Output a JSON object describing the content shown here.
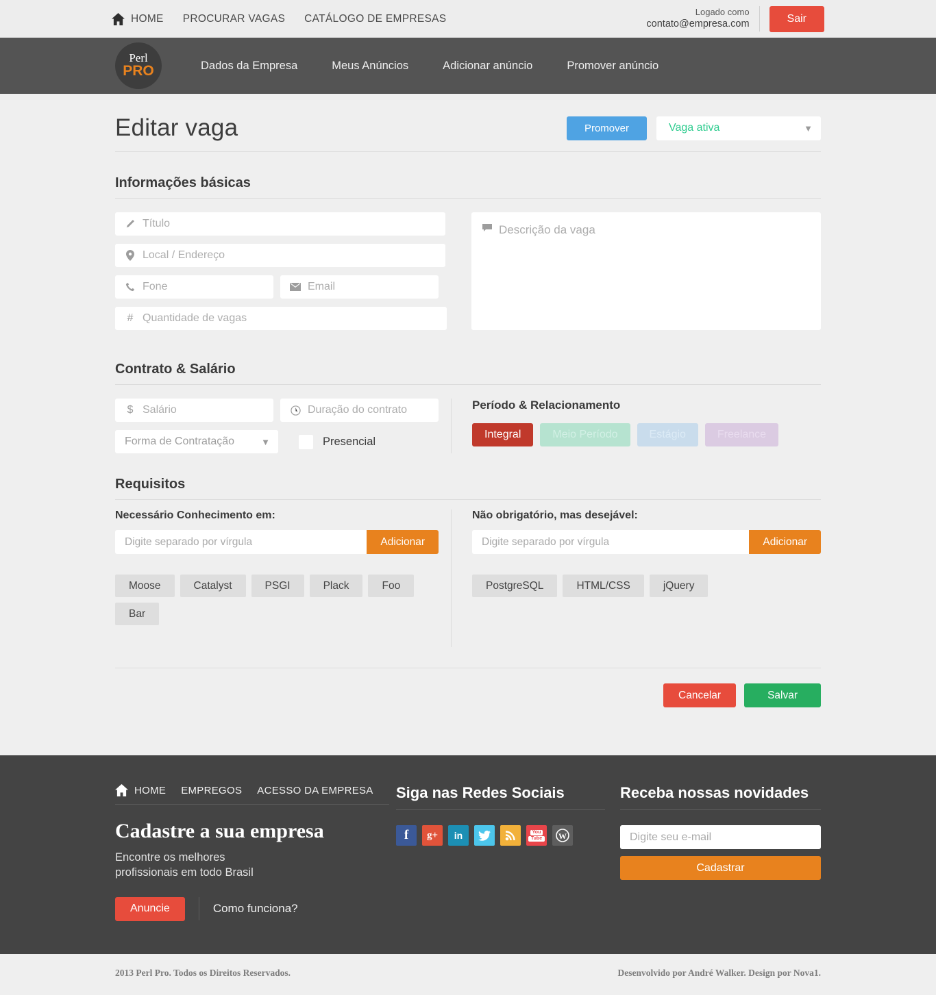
{
  "topbar": {
    "home_label": "HOME",
    "nav": [
      {
        "label": "PROCURAR VAGAS"
      },
      {
        "label": "CATÁLOGO DE EMPRESAS"
      }
    ],
    "logged_as_label": "Logado como",
    "logged_email": "contato@empresa.com",
    "logout_label": "Sair"
  },
  "brandnav": {
    "logo_top": "Perl",
    "logo_bottom": "PRO",
    "items": [
      {
        "label": "Dados da Empresa"
      },
      {
        "label": "Meus Anúncios"
      },
      {
        "label": "Adicionar anúncio"
      },
      {
        "label": "Promover anúncio"
      }
    ]
  },
  "page": {
    "title": "Editar vaga",
    "promote_label": "Promover",
    "status_value": "Vaga ativa"
  },
  "basic": {
    "section_title": "Informações básicas",
    "title_placeholder": "Título",
    "location_placeholder": "Local / Endereço",
    "phone_placeholder": "Fone",
    "email_placeholder": "Email",
    "quantity_placeholder": "Quantidade de vagas",
    "description_placeholder": "Descrição da vaga"
  },
  "contract": {
    "section_title": "Contrato & Salário",
    "salary_placeholder": "Salário",
    "duration_placeholder": "Duração do contrato",
    "hiring_type_placeholder": "Forma de Contratação",
    "onsite_label": "Presencial",
    "period_title": "Período & Relacionamento",
    "period_tags": [
      {
        "label": "Integral",
        "state": "active"
      },
      {
        "label": "Meio Período",
        "state": "green"
      },
      {
        "label": "Estágio",
        "state": "blue"
      },
      {
        "label": "Freelance",
        "state": "purple"
      }
    ]
  },
  "requirements": {
    "section_title": "Requisitos",
    "required_label": "Necessário Conhecimento em:",
    "optional_label": "Não obrigatório, mas desejável:",
    "input_placeholder": "Digite separado por vírgula",
    "add_label": "Adicionar",
    "required_tags": [
      "Moose",
      "Catalyst",
      "PSGI",
      "Plack",
      "Foo",
      "Bar"
    ],
    "optional_tags": [
      "PostgreSQL",
      "HTML/CSS",
      "jQuery"
    ]
  },
  "form_actions": {
    "cancel_label": "Cancelar",
    "save_label": "Salvar"
  },
  "footer": {
    "nav_home": "HOME",
    "nav": [
      {
        "label": "EMPREGOS"
      },
      {
        "label": "ACESSO DA EMPRESA"
      }
    ],
    "cta_title": "Cadastre a sua empresa",
    "cta_line1": "Encontre os melhores",
    "cta_line2": "profissionais em todo Brasil",
    "cta_button": "Anuncie",
    "cta_link": "Como funciona?",
    "social_title": "Siga nas Redes Sociais",
    "socials": [
      {
        "name": "facebook-icon",
        "glyph": "f",
        "color": "#3b5998"
      },
      {
        "name": "google-plus-icon",
        "glyph": "g+",
        "color": "#e0533a"
      },
      {
        "name": "linkedin-icon",
        "glyph": "in",
        "color": "#1c8fb4"
      },
      {
        "name": "twitter-icon",
        "glyph": "t",
        "color": "#4cc6ec"
      },
      {
        "name": "rss-icon",
        "glyph": "r",
        "color": "#f2b13a"
      },
      {
        "name": "youtube-icon",
        "glyph": "You",
        "color": "#e8454a"
      },
      {
        "name": "wordpress-icon",
        "glyph": "W",
        "color": "#5e5e5e"
      }
    ],
    "newsletter_title": "Receba nossas novidades",
    "newsletter_placeholder": "Digite seu e-mail",
    "newsletter_button": "Cadastrar",
    "copyright": "2013 Perl Pro. Todos os Direitos Reservados.",
    "credits": "Desenvolvido por André Walker. Design por Nova1."
  },
  "colors": {
    "accent_orange": "#e8821e",
    "danger_red": "#e74c3c",
    "success_green": "#27ae60",
    "info_blue": "#4fa3e3",
    "status_green": "#2ecc8f",
    "dark_nav": "#545454",
    "footer_dark": "#444444"
  }
}
